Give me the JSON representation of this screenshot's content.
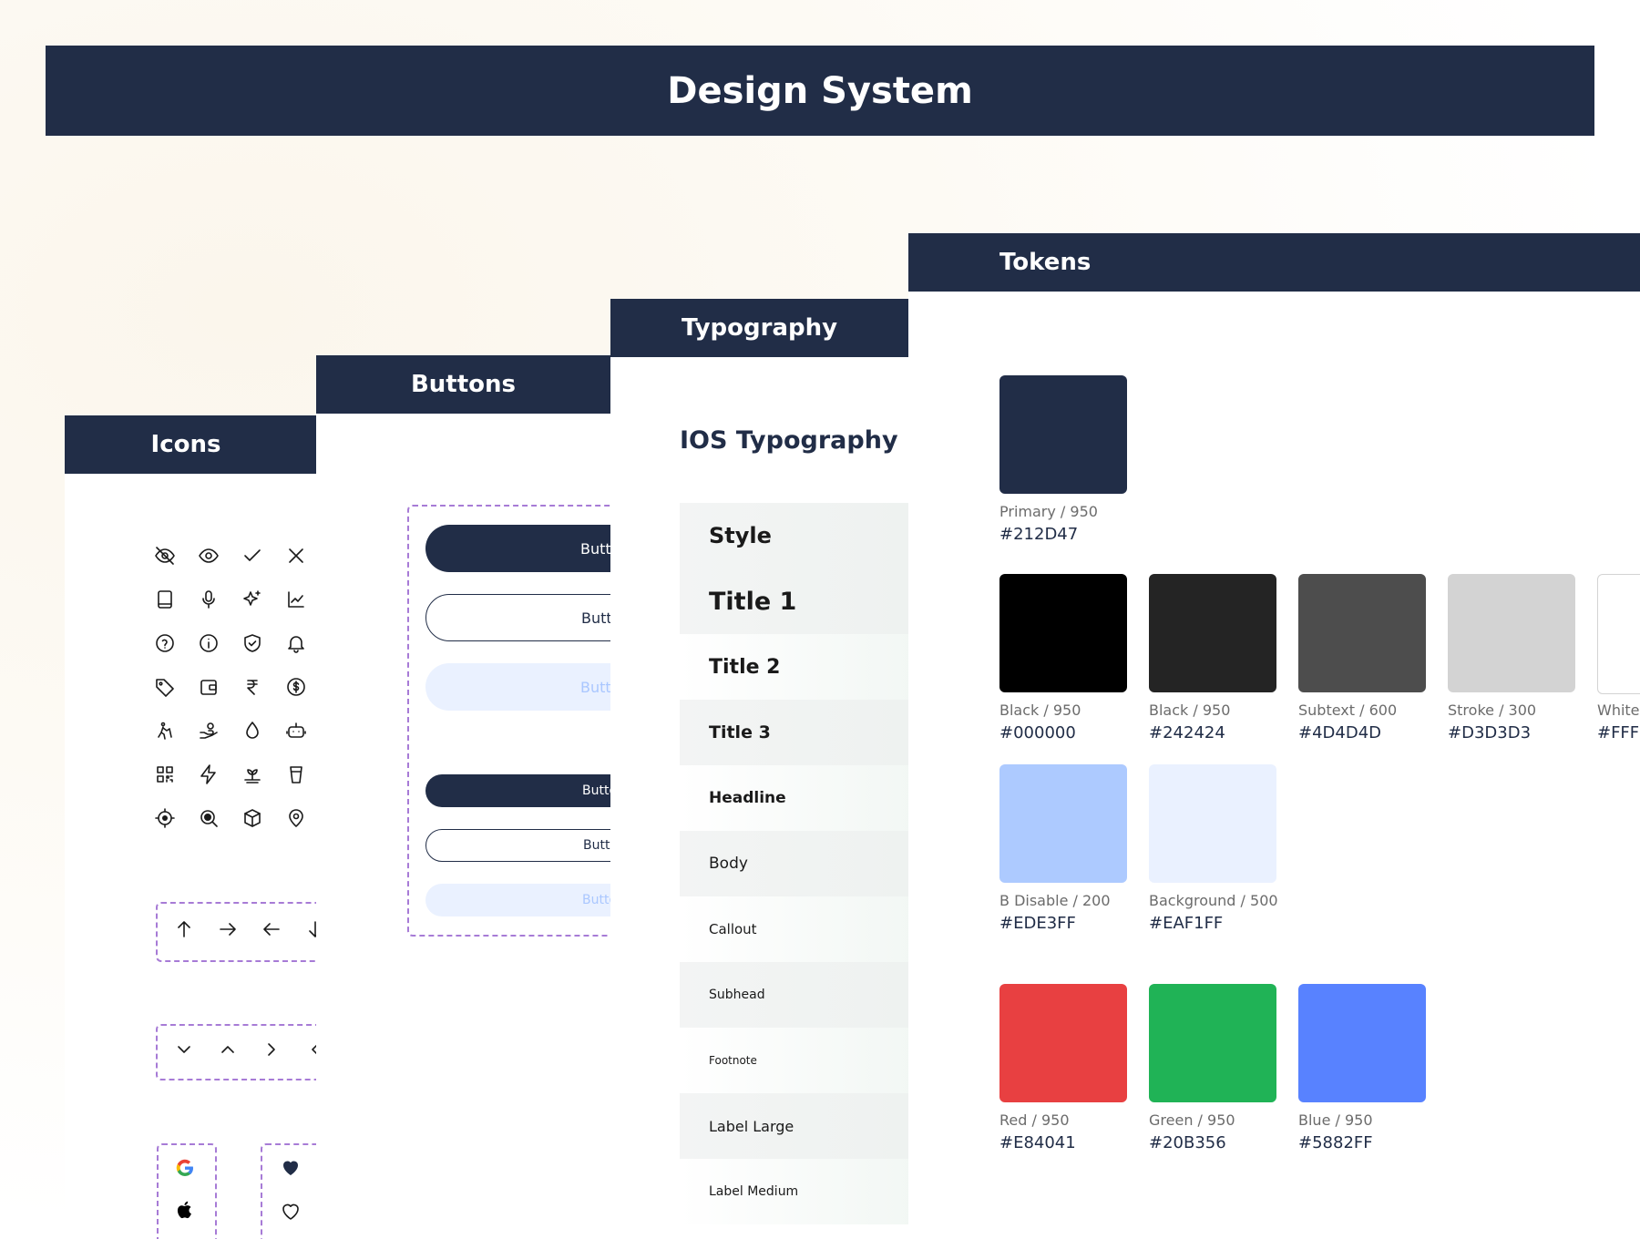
{
  "banner": {
    "title": "Design System"
  },
  "icons": {
    "title": "Icons",
    "grid": [
      "eye-off-icon",
      "eye-icon",
      "check-icon",
      "close-icon",
      "book-icon",
      "microphone-icon",
      "sparkle-icon",
      "chart-up-icon",
      "help-icon",
      "info-icon",
      "shield-check-icon",
      "bell-icon",
      "tag-icon",
      "wallet-icon",
      "rupee-icon",
      "dollar-icon",
      "dog-walk-icon",
      "hand-coin-icon",
      "drop-icon",
      "robot-icon",
      "qr-code-icon",
      "lightning-icon",
      "plant-icon",
      "cup-icon",
      "target-icon",
      "search-icon",
      "box-icon",
      "location-icon"
    ],
    "arrows": [
      "arrow-up-icon",
      "arrow-right-icon",
      "arrow-left-icon",
      "arrow-down-icon"
    ],
    "chevrons": [
      "chevron-down-icon",
      "chevron-up-icon",
      "chevron-right-icon",
      "chevron-left-icon"
    ],
    "brands": [
      "google-icon",
      "apple-icon",
      "heart-filled-icon",
      "heart-outline-icon"
    ]
  },
  "buttons": {
    "title": "Buttons",
    "items": [
      {
        "variant": "fill",
        "label": "Button"
      },
      {
        "variant": "out",
        "label": "Button"
      },
      {
        "variant": "dis",
        "label": "Button"
      },
      {
        "variant": "fill",
        "label": "Button"
      },
      {
        "variant": "out",
        "label": "Button"
      },
      {
        "variant": "dis",
        "label": "Button"
      }
    ]
  },
  "typography": {
    "title": "Typography",
    "heading": "IOS Typography (De",
    "rows": [
      "Style",
      "Title 1",
      "Title 2",
      "Title 3",
      "Headline",
      "Body",
      "Callout",
      "Subhead",
      "Footnote",
      "Label Large",
      "Label Medium"
    ]
  },
  "tokens": {
    "title": "Tokens",
    "swatches": [
      {
        "name": "Primary / 950",
        "hex": "#212D47",
        "color": "#212D47"
      },
      {
        "name": "Black / 950",
        "hex": "#000000",
        "color": "#000000"
      },
      {
        "name": "Black / 950",
        "hex": "#242424",
        "color": "#242424"
      },
      {
        "name": "Subtext / 600",
        "hex": "#4D4D4D",
        "color": "#4D4D4D"
      },
      {
        "name": "Stroke / 300",
        "hex": "#D3D3D3",
        "color": "#D3D3D3"
      },
      {
        "name": "White",
        "hex": "#FFFF",
        "color": "#FFFFFF"
      },
      {
        "name": "B Disable / 200",
        "hex": "#EDE3FF",
        "color": "#ADCAFF"
      },
      {
        "name": "Background / 500",
        "hex": "#EAF1FF",
        "color": "#EAF1FF"
      },
      {
        "name": "Red / 950",
        "hex": "#E84041",
        "color": "#E84041"
      },
      {
        "name": "Green / 950",
        "hex": "#20B356",
        "color": "#20B356"
      },
      {
        "name": "Blue / 950",
        "hex": "#5882FF",
        "color": "#5882FF"
      }
    ]
  }
}
